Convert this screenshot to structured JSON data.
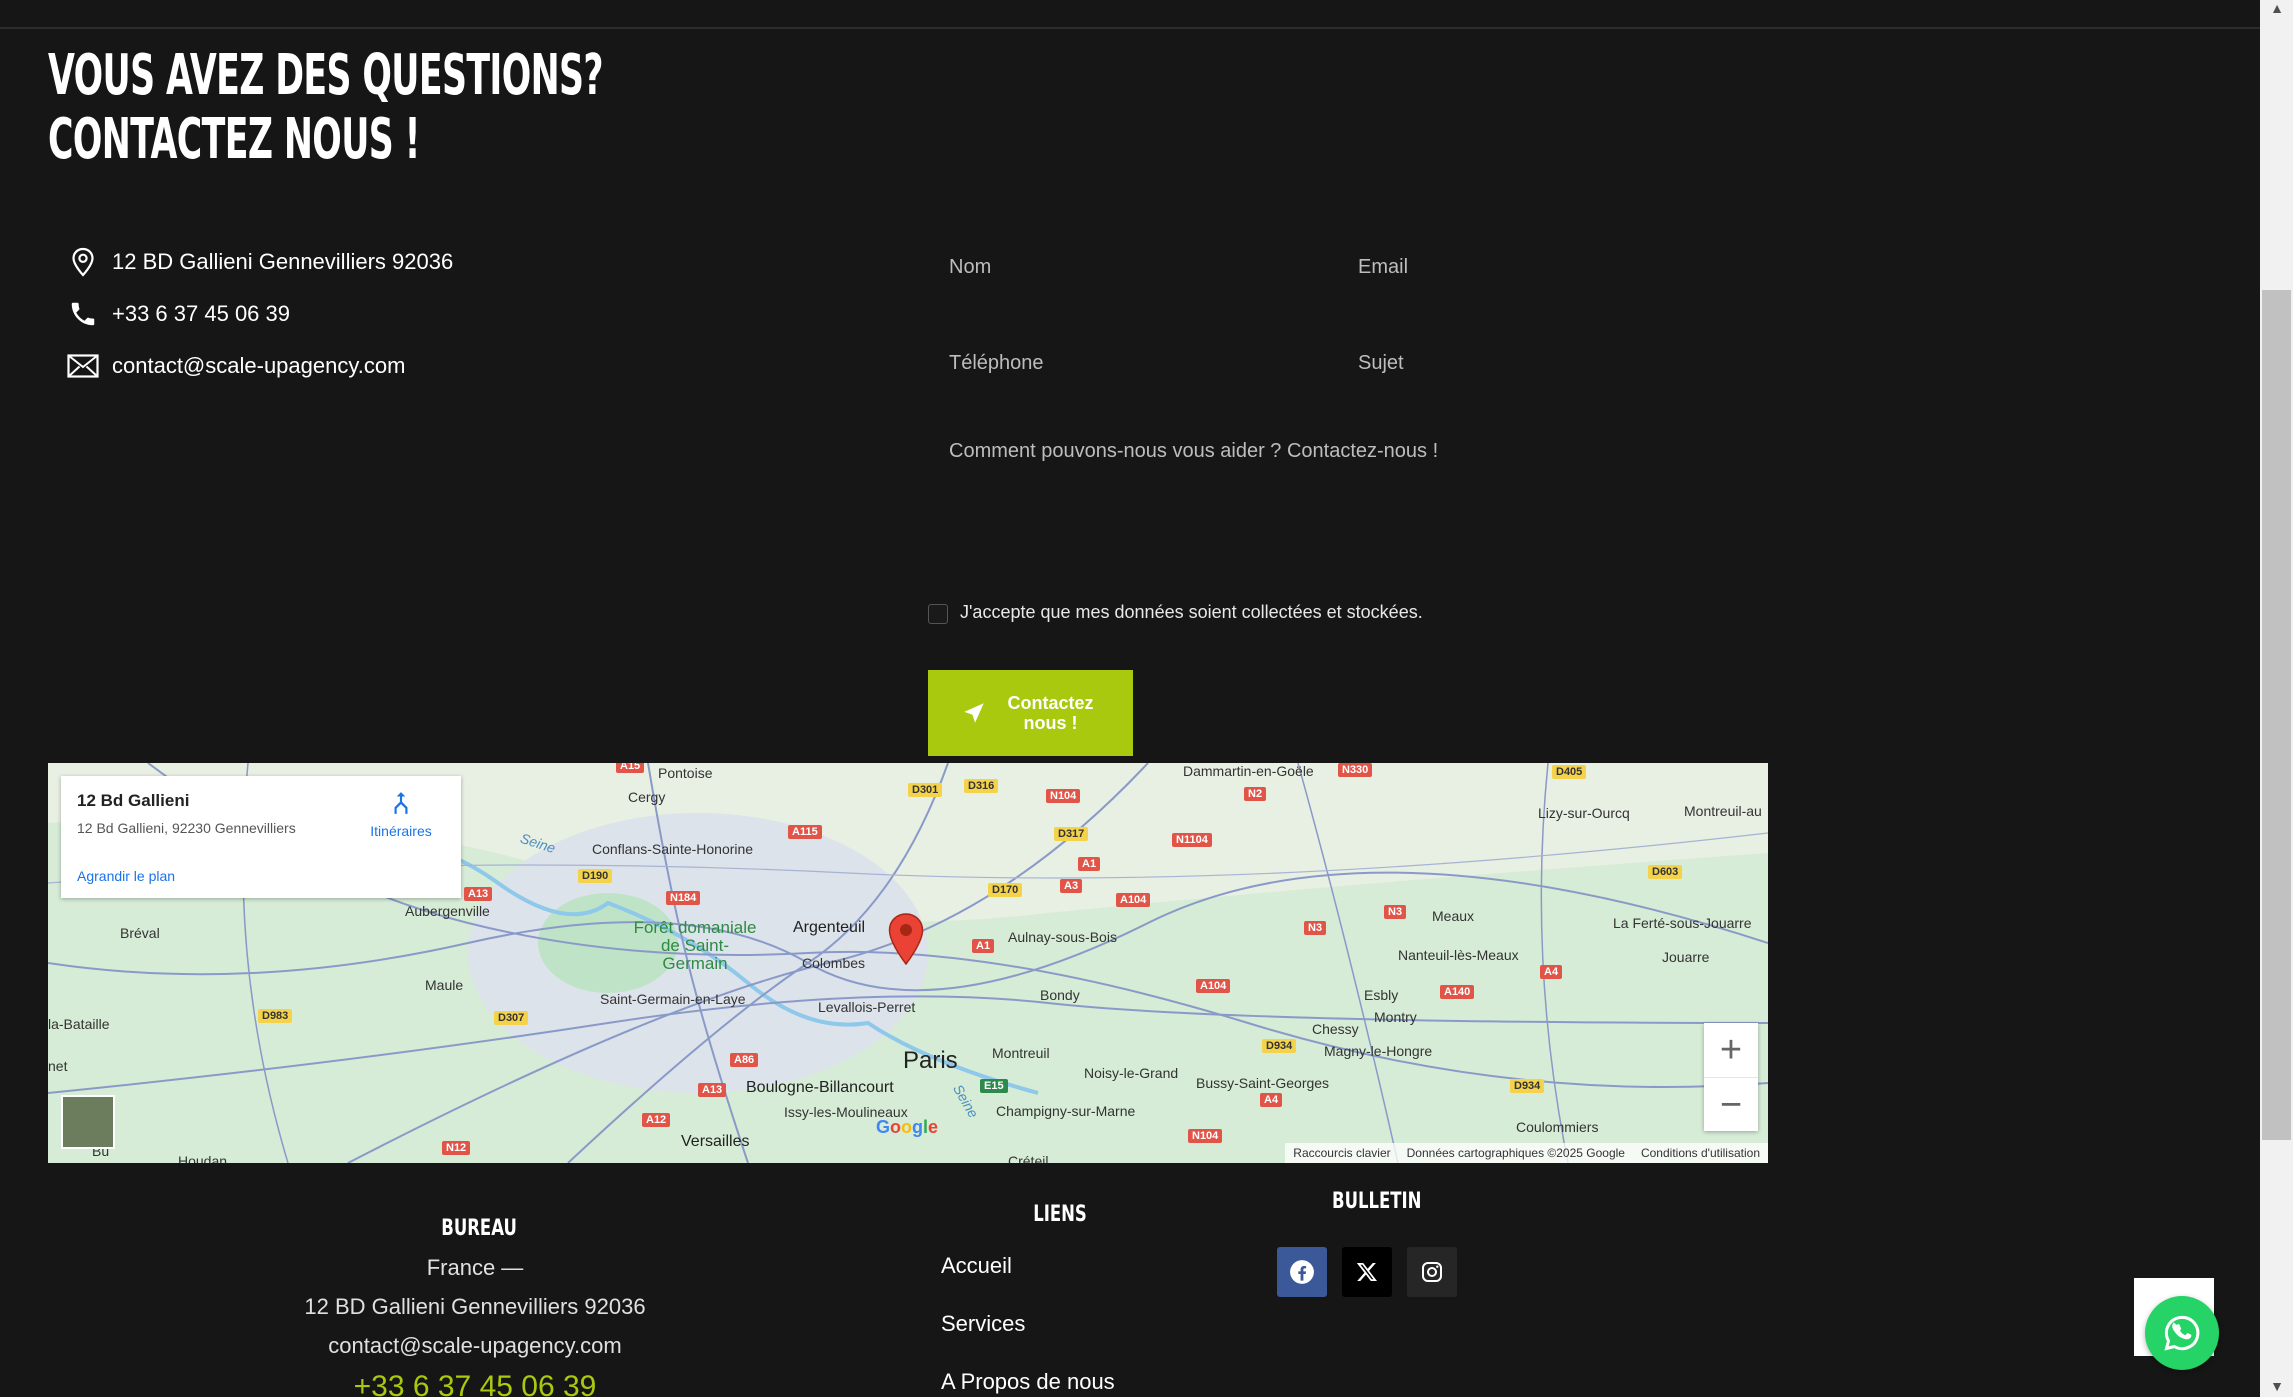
{
  "heading": {
    "line1": "VOUS AVEZ DES QUESTIONS?",
    "line2": "CONTACTEZ NOUS !"
  },
  "contact_info": {
    "address": "12 BD Gallieni Gennevilliers 92036",
    "phone": "+33 6 37 45 06 39",
    "email": "contact@scale-upagency.com"
  },
  "form": {
    "nom_placeholder": "Nom",
    "email_placeholder": "Email",
    "telephone_placeholder": "Téléphone",
    "sujet_placeholder": "Sujet",
    "message_placeholder": "Comment pouvons-nous vous aider ? Contactez-nous !",
    "consent_label": "J'accepte que mes données soient collectées et stockées.",
    "submit_label": "Contactez nous !"
  },
  "map": {
    "card_title": "12 Bd Gallieni",
    "card_address": "12 Bd Gallieni, 92230 Gennevilliers",
    "directions_label": "Itinéraires",
    "enlarge_label": "Agrandir le plan",
    "zoom_in": "+",
    "zoom_out": "−",
    "google_logo": "Google",
    "footer_shortcuts": "Raccourcis clavier",
    "footer_data": "Données cartographiques ©2025 Google",
    "footer_terms": "Conditions d'utilisation",
    "places": {
      "paris": "Paris",
      "argenteuil": "Argenteuil",
      "colombes": "Colombes",
      "levallois": "Levallois-Perret",
      "boulogne": "Boulogne-Billancourt",
      "issy": "Issy-les-Moulineaux",
      "versailles": "Versailles",
      "cergy": "Cergy",
      "pontoise": "Pontoise",
      "conflans": "Conflans-Sainte-Honorine",
      "aubergenville": "Aubergenville",
      "breval": "Bréval",
      "maule": "Maule",
      "labataille": "la-Bataille",
      "saint_germain": "Saint-Germain-en-Laye",
      "foret": "Forêt domaniale de Saint-Germain",
      "aulnay": "Aulnay-sous-Bois",
      "bondy": "Bondy",
      "montreuil": "Montreuil",
      "noisy": "Noisy-le-Grand",
      "champigny": "Champigny-sur-Marne",
      "bussy": "Bussy-Saint-Georges",
      "chessy": "Chessy",
      "esbly": "Esbly",
      "montry": "Montry",
      "magny": "Magny-le-Hongre",
      "meaux": "Meaux",
      "nanteuil": "Nanteuil-lès-Meaux",
      "dammartin": "Dammartin-en-Goële",
      "lizy": "Lizy-sur-Ourcq",
      "montreuil_aux": "Montreuil-au",
      "laferte": "La Ferté-sous-Jouarre",
      "jouarre": "Jouarre",
      "coulommiers": "Coulommiers",
      "creteil": "Créteil",
      "houdan": "Houdan",
      "seine1": "Seine",
      "seine2": "Seine",
      "net": "net",
      "bu": "Bu"
    },
    "roads": {
      "a15": "A15",
      "d301": "D301",
      "d316": "D316",
      "n104a": "N104",
      "n2": "N2",
      "n330": "N330",
      "d405": "D405",
      "a115": "A115",
      "d317": "D317",
      "n1104": "N1104",
      "d190": "D190",
      "n184": "N184",
      "d170": "D170",
      "a3": "A3",
      "a1a": "A1",
      "a104": "A104",
      "d603": "D603",
      "a13a": "A13",
      "n3a": "N3",
      "n3b": "N3",
      "a1b": "A1",
      "a4a": "A4",
      "a140": "A140",
      "a104b": "A104",
      "d983": "D983",
      "d307": "D307",
      "a86": "A86",
      "d934a": "D934",
      "d934b": "D934",
      "a13b": "A13",
      "e15": "E15",
      "a4b": "A4",
      "a12": "A12",
      "n104b": "N104",
      "n12": "N12"
    }
  },
  "footer": {
    "bureau_title": "BUREAU",
    "bureau_country": "France —",
    "bureau_address": "12 BD Gallieni Gennevilliers 92036",
    "bureau_email": "contact@scale-upagency.com",
    "bureau_phone": "+33 6 37 45 06 39",
    "liens_title": "LIENS",
    "liens": [
      "Accueil",
      "Services",
      "A Propos de nous"
    ],
    "bulletin_title": "BULLETIN",
    "social_icons": [
      "facebook-icon",
      "x-icon",
      "instagram-icon"
    ]
  },
  "colors": {
    "background": "#161616",
    "accent": "#a9c90e",
    "facebook": "#3b5998",
    "whatsapp": "#25d366"
  }
}
